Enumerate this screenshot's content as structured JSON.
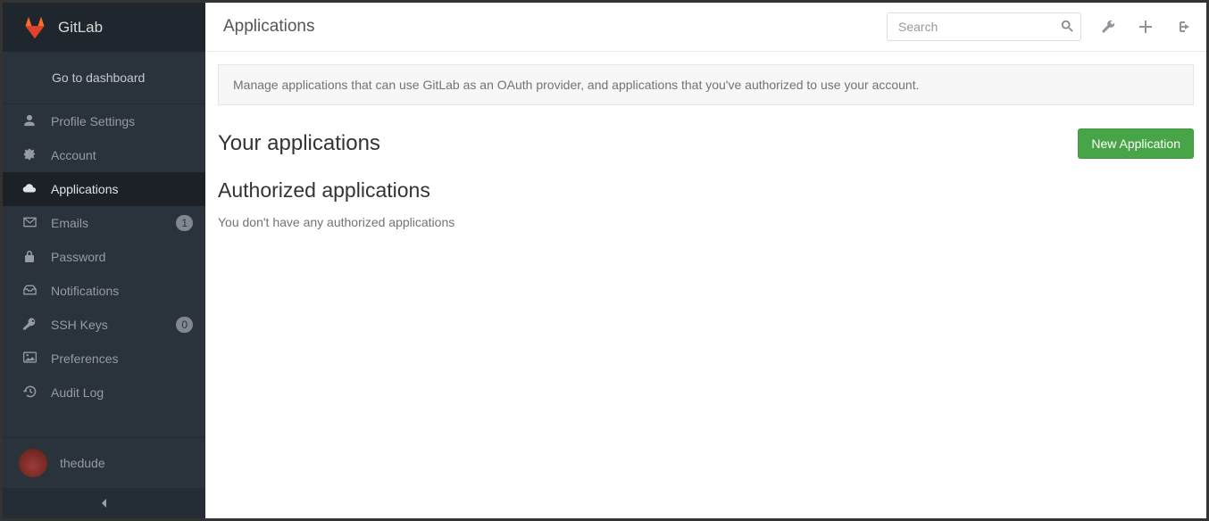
{
  "brand": {
    "name": "GitLab"
  },
  "sidebar": {
    "dashboard": "Go to dashboard",
    "items": [
      {
        "icon": "user",
        "label": "Profile Settings",
        "badge": null,
        "active": false
      },
      {
        "icon": "gear",
        "label": "Account",
        "badge": null,
        "active": false
      },
      {
        "icon": "cloud",
        "label": "Applications",
        "badge": null,
        "active": true
      },
      {
        "icon": "mail",
        "label": "Emails",
        "badge": "1",
        "active": false
      },
      {
        "icon": "lock",
        "label": "Password",
        "badge": null,
        "active": false
      },
      {
        "icon": "inbox",
        "label": "Notifications",
        "badge": null,
        "active": false
      },
      {
        "icon": "key",
        "label": "SSH Keys",
        "badge": "0",
        "active": false
      },
      {
        "icon": "picture",
        "label": "Preferences",
        "badge": null,
        "active": false
      },
      {
        "icon": "history",
        "label": "Audit Log",
        "badge": null,
        "active": false
      }
    ],
    "user": "thedude"
  },
  "header": {
    "title": "Applications",
    "search_placeholder": "Search"
  },
  "main": {
    "info": "Manage applications that can use GitLab as an OAuth provider, and applications that you've authorized to use your account.",
    "your_apps_heading": "Your applications",
    "new_app_button": "New Application",
    "authorized_heading": "Authorized applications",
    "authorized_empty": "You don't have any authorized applications"
  }
}
